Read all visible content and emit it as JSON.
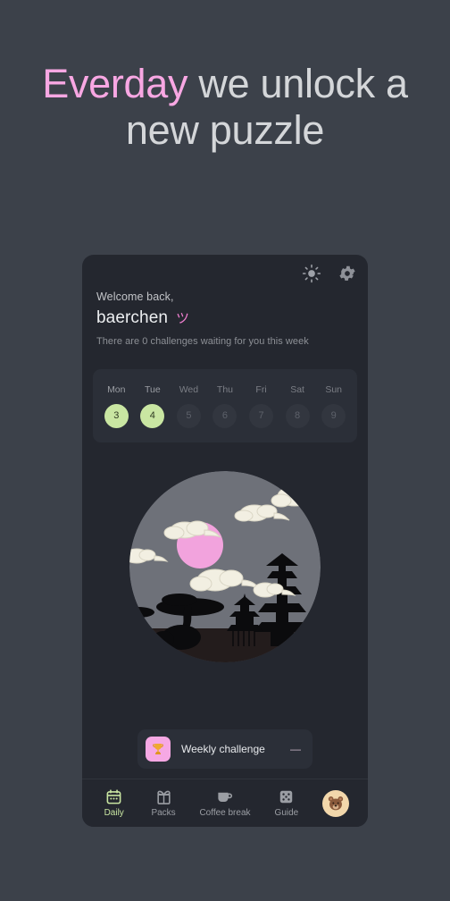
{
  "headline": {
    "accent_word": "Everday",
    "rest": " we unlock a new puzzle"
  },
  "colors": {
    "background": "#3c414a",
    "card": "#24272f",
    "panel": "#2b2f38",
    "accent_pink": "#f8a7e3",
    "accent_green": "#c9e6a2",
    "moon_pink": "#f2a3dd",
    "sky_gray": "#6e7179",
    "cloud_cream": "#f2efe2"
  },
  "card": {
    "top_icons": [
      {
        "name": "brightness-icon",
        "label": "Brightness"
      },
      {
        "name": "settings-gear-icon",
        "label": "Settings"
      }
    ],
    "greeting": {
      "hello": "Welcome back,",
      "username": "baerchen",
      "smiley": "ツ",
      "subtitle": "There are 0 challenges waiting for you this week"
    },
    "week": {
      "days": [
        {
          "name": "Mon",
          "number": "3",
          "active": true
        },
        {
          "name": "Tue",
          "number": "4",
          "active": true
        },
        {
          "name": "Wed",
          "number": "5",
          "active": false
        },
        {
          "name": "Thu",
          "number": "6",
          "active": false
        },
        {
          "name": "Fri",
          "number": "7",
          "active": false
        },
        {
          "name": "Sat",
          "number": "8",
          "active": false
        },
        {
          "name": "Sun",
          "number": "9",
          "active": false
        }
      ]
    },
    "illustration": {
      "name": "night-pagoda-moon-illustration"
    },
    "challenge": {
      "icon": "trophy-icon",
      "label": "Weekly challenge",
      "value": "—"
    },
    "nav": [
      {
        "label": "Daily",
        "icon": "calendar-icon",
        "active": true
      },
      {
        "label": "Packs",
        "icon": "gift-box-icon",
        "active": false
      },
      {
        "label": "Coffee break",
        "icon": "coffee-cup-icon",
        "active": false
      },
      {
        "label": "Guide",
        "icon": "dice-icon",
        "active": false
      }
    ],
    "avatar": {
      "name": "bear-avatar"
    }
  }
}
